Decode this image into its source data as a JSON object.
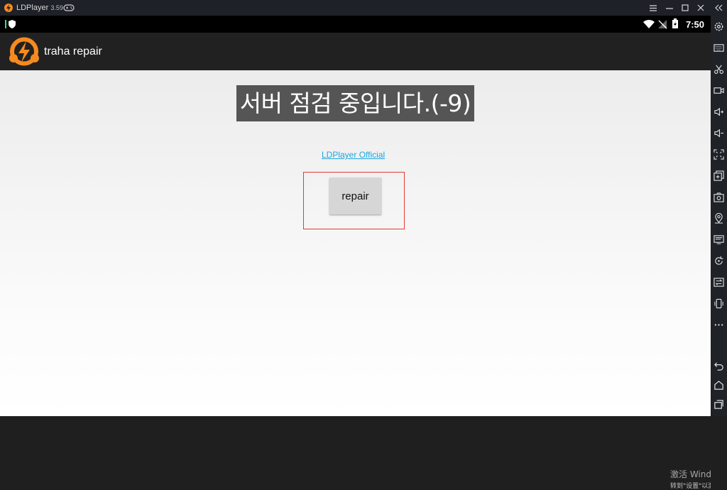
{
  "window": {
    "app_name": "LDPlayer",
    "version": "3.59"
  },
  "status_bar": {
    "time": "7:50"
  },
  "app_bar": {
    "title": "traha repair"
  },
  "content": {
    "notice": "서버 점검 중입니다.(-9)",
    "link_text": "LDPlayer Official",
    "repair_label": "repair"
  },
  "watermark": {
    "line1": "激活 Windows",
    "line2": "转到\"设置\"以激活Windows"
  },
  "toolbar_icons": [
    "settings-icon",
    "keyboard-icon",
    "scissors-icon",
    "record-icon",
    "volume-up-icon",
    "volume-down-icon",
    "fullscreen-icon",
    "add-apk-icon",
    "screenshot-icon",
    "location-icon",
    "shared-folder-icon",
    "sync-icon",
    "operation-record-icon",
    "shake-icon",
    "more-icon",
    "back-icon",
    "home-icon",
    "recent-apps-icon"
  ],
  "colors": {
    "accent": "#f58a1f",
    "link": "#1aa6e0",
    "highlight": "#e53935"
  }
}
